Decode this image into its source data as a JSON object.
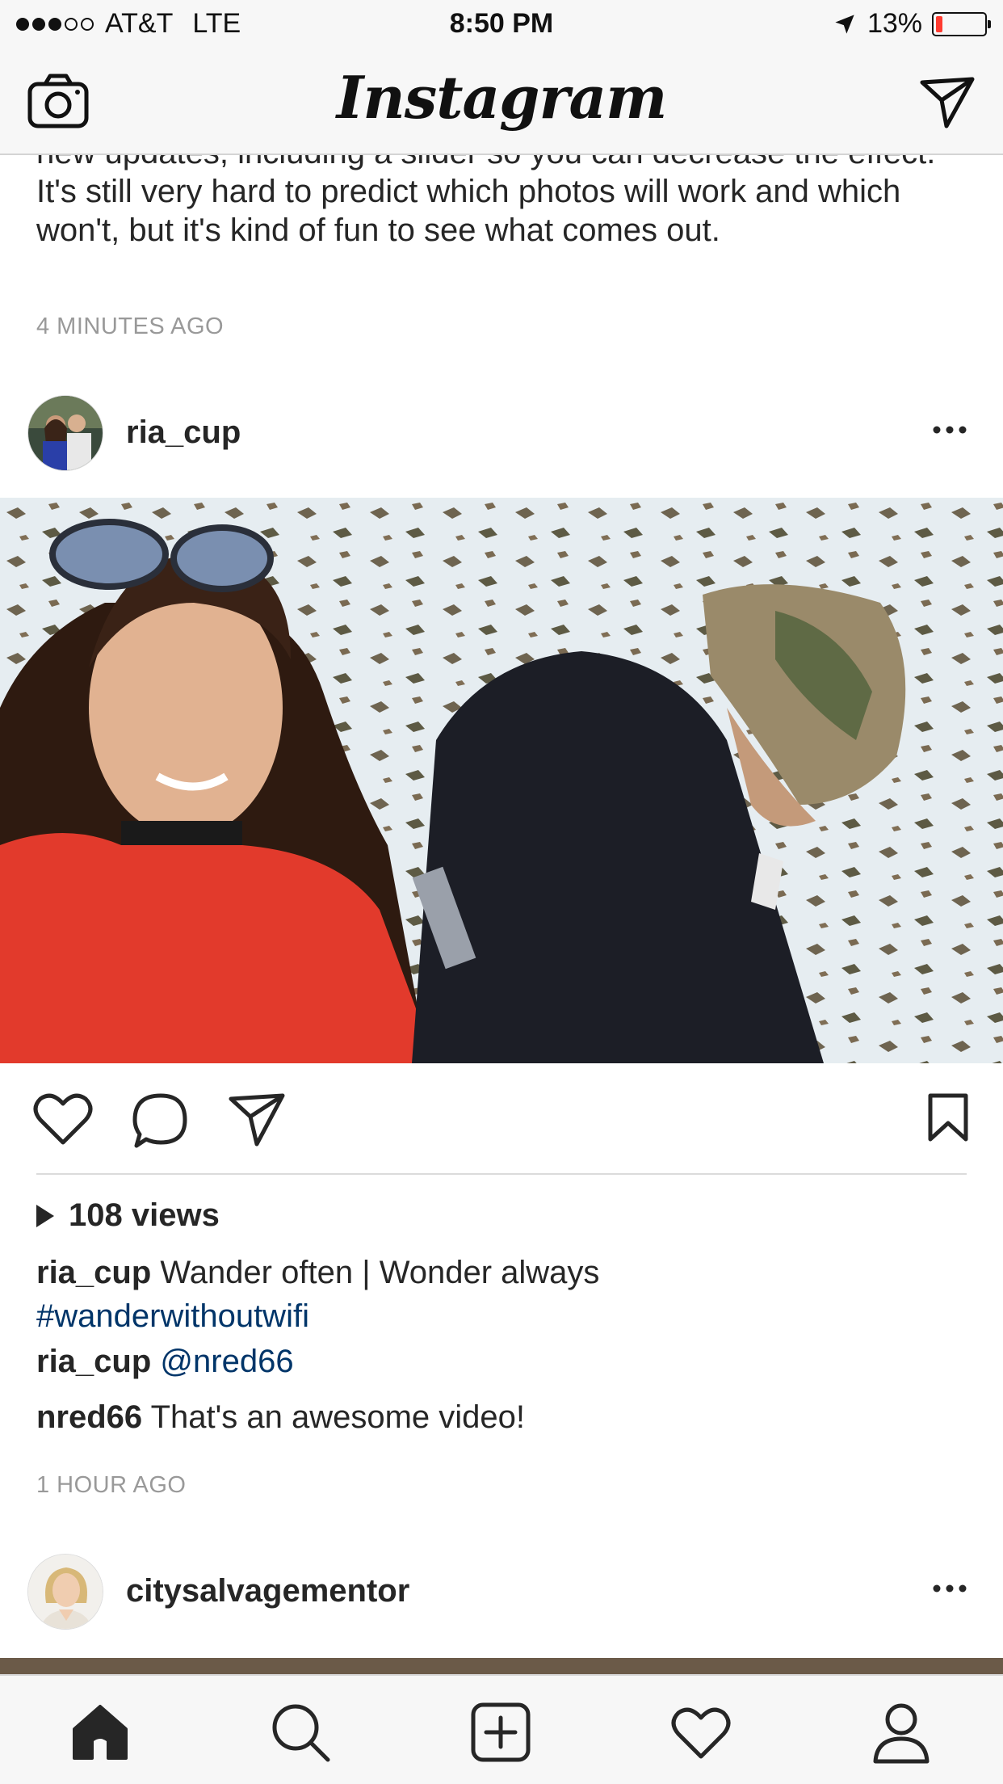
{
  "status_bar": {
    "carrier": "AT&T",
    "network": "LTE",
    "time": "8:50 PM",
    "battery": "13%",
    "battery_level": 0.13,
    "signal_bars": 3
  },
  "nav": {
    "logo": "Instagram"
  },
  "previous_post": {
    "caption": "new updates, including a slider so you can decrease the effect. It's still very hard to predict which photos will work and which won't, but it's kind of fun to see what comes out.",
    "time": "4 MINUTES AGO"
  },
  "post": {
    "username": "ria_cup",
    "views": "108 views",
    "caption_user": "ria_cup",
    "caption_text": "Wander often | Wonder always",
    "hashtag": "#wanderwithoutwifi",
    "comments": [
      {
        "user": "ria_cup",
        "text": "@nred66",
        "is_mention": true
      },
      {
        "user": "nred66",
        "text": "That's an awesome video!",
        "is_mention": false
      }
    ],
    "time": "1 HOUR AGO"
  },
  "next_post": {
    "username": "citysalvagementor"
  },
  "tabs": [
    {
      "icon": "home-icon",
      "active": true
    },
    {
      "icon": "search-icon",
      "active": false
    },
    {
      "icon": "add-icon",
      "active": false
    },
    {
      "icon": "heart-icon",
      "active": false
    },
    {
      "icon": "profile-icon",
      "active": false
    }
  ],
  "colors": {
    "link": "#003569",
    "meta": "#999999",
    "battery_low": "#ff3b30"
  }
}
